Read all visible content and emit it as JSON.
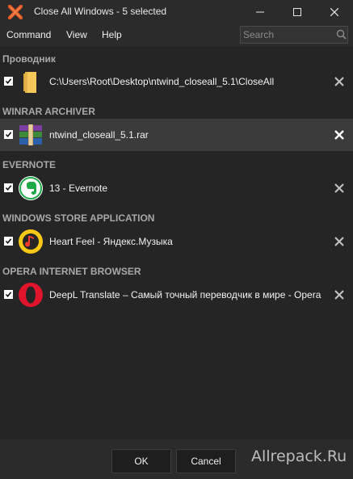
{
  "window": {
    "title": "Close All Windows - 5 selected",
    "accent_color": "#e0592a"
  },
  "menu": {
    "command": "Command",
    "view": "View",
    "help": "Help"
  },
  "search": {
    "placeholder": "Search",
    "value": ""
  },
  "groups": [
    {
      "header": "Проводник",
      "items": [
        {
          "label": "C:\\Users\\Root\\Desktop\\ntwind_closeall_5.1\\CloseAll",
          "icon": "folder-icon",
          "checked": true,
          "selected": false
        }
      ]
    },
    {
      "header": "WINRAR ARCHIVER",
      "items": [
        {
          "label": "ntwind_closeall_5.1.rar",
          "icon": "winrar-icon",
          "checked": true,
          "selected": true
        }
      ]
    },
    {
      "header": "EVERNOTE",
      "items": [
        {
          "label": "13 - Evernote",
          "icon": "evernote-icon",
          "checked": true,
          "selected": false
        }
      ]
    },
    {
      "header": "WINDOWS STORE APPLICATION",
      "items": [
        {
          "label": "Heart Feel - Яндекс.Музыка",
          "icon": "yandex-music-icon",
          "checked": true,
          "selected": false
        }
      ]
    },
    {
      "header": "OPERA INTERNET BROWSER",
      "items": [
        {
          "label": "DeepL Translate – Самый точный переводчик в мире - Opera",
          "icon": "opera-icon",
          "checked": true,
          "selected": false
        }
      ]
    }
  ],
  "buttons": {
    "ok": "OK",
    "cancel": "Cancel"
  },
  "watermark": "Allrepack.Ru"
}
